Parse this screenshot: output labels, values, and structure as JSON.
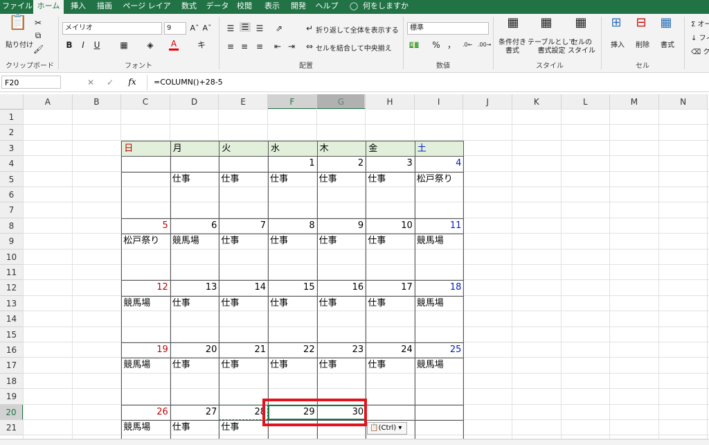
{
  "menu_tabs": [
    "ファイル",
    "ホーム",
    "挿入",
    "描画",
    "ページ レイアウト",
    "数式",
    "データ",
    "校閲",
    "表示",
    "開発",
    "ヘルプ",
    "何をしますか"
  ],
  "active_tab": "ホーム",
  "ribbon": {
    "clipboard": {
      "paste_label": "貼り付け",
      "group_label": "クリップボード"
    },
    "font": {
      "font_name": "メイリオ",
      "font_size": "9",
      "group_label": "フォント",
      "bold": "B",
      "italic": "I",
      "underline": "U"
    },
    "alignment": {
      "wrap_label": "折り返して全体を表示する",
      "merge_label": "セルを結合して中央揃え",
      "group_label": "配置"
    },
    "number": {
      "format": "標準",
      "percent": "%",
      "comma": "，",
      "group_label": "数値"
    },
    "styles": {
      "conditional": "条件付き\n書式",
      "table": "テーブルとして\n書式設定",
      "cell_styles": "セルの\nスタイル",
      "group_label": "スタイル"
    },
    "cells": {
      "insert": "挿入",
      "delete": "削除",
      "format": "書式",
      "group_label": "セル"
    },
    "editing": {
      "sum": "オー",
      "fill": "フィ",
      "clear": "クリ"
    }
  },
  "formula_bar": {
    "name_box": "F20",
    "fx": "fx",
    "formula": "=COLUMN()+28-5"
  },
  "columns": [
    "A",
    "B",
    "C",
    "D",
    "E",
    "F",
    "G",
    "H",
    "I",
    "J",
    "K",
    "L",
    "M",
    "N"
  ],
  "selected_columns": [
    "F",
    "G"
  ],
  "selected_row": "20",
  "rows": [
    "1",
    "2",
    "3",
    "4",
    "5",
    "6",
    "7",
    "8",
    "9",
    "10",
    "11",
    "12",
    "13",
    "14",
    "15",
    "16",
    "17",
    "18",
    "19",
    "20",
    "21"
  ],
  "calendar": {
    "weekdays": [
      "日",
      "月",
      "火",
      "水",
      "木",
      "金",
      "土"
    ],
    "weeks": [
      {
        "dates": [
          "",
          "",
          "",
          "1",
          "2",
          "3",
          "4"
        ],
        "events": [
          "",
          "仕事",
          "仕事",
          "仕事",
          "仕事",
          "仕事",
          "松戸祭り"
        ]
      },
      {
        "dates": [
          "5",
          "6",
          "7",
          "8",
          "9",
          "10",
          "11"
        ],
        "events": [
          "松戸祭り",
          "競馬場",
          "仕事",
          "仕事",
          "仕事",
          "仕事",
          "競馬場"
        ]
      },
      {
        "dates": [
          "12",
          "13",
          "14",
          "15",
          "16",
          "17",
          "18"
        ],
        "events": [
          "競馬場",
          "仕事",
          "仕事",
          "仕事",
          "仕事",
          "仕事",
          "競馬場"
        ]
      },
      {
        "dates": [
          "19",
          "20",
          "21",
          "22",
          "23",
          "24",
          "25"
        ],
        "events": [
          "競馬場",
          "仕事",
          "仕事",
          "仕事",
          "仕事",
          "仕事",
          "競馬場"
        ]
      },
      {
        "dates": [
          "26",
          "27",
          "28",
          "29",
          "30",
          "",
          ""
        ],
        "events": [
          "競馬場",
          "仕事",
          "仕事",
          "",
          "",
          "",
          ""
        ]
      }
    ]
  },
  "paste_options": "(Ctrl)",
  "colors": {
    "sunday": "#c00000",
    "saturday": "#0020c0",
    "header_fill": "#e2efda",
    "highlight_box": "#e0141e",
    "excel_green": "#217346"
  }
}
